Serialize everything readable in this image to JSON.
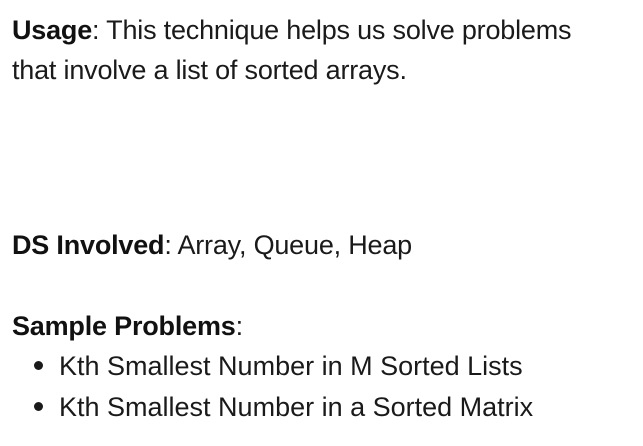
{
  "usage": {
    "label": "Usage",
    "text": ": This technique helps us solve problems",
    "text2": "that involve a list of sorted arrays."
  },
  "ds": {
    "label": "DS Involved",
    "text": ": Array, Queue, Heap"
  },
  "samples": {
    "label": "Sample Problems",
    "colon": ":",
    "items": [
      "Kth Smallest Number in M Sorted Lists",
      "Kth Smallest Number in a Sorted Matrix"
    ]
  }
}
